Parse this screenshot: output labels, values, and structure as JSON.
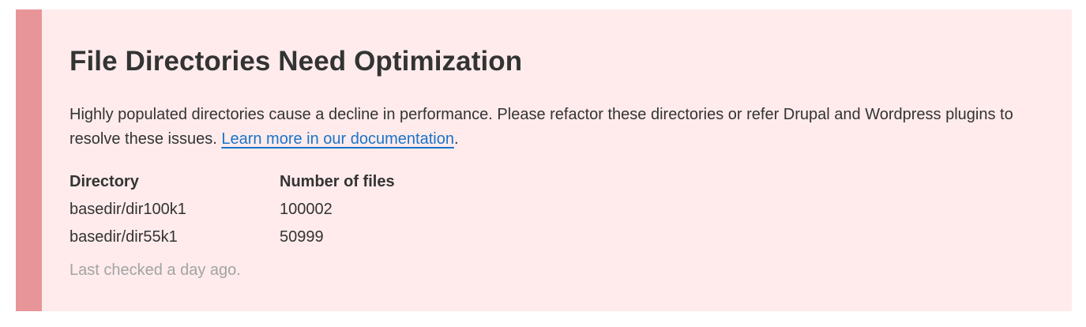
{
  "notice": {
    "title": "File Directories Need Optimization",
    "description_text": "Highly populated directories cause a decline in performance. Please refactor these directories or refer Drupal and Wordpress plugins to resolve these issues. ",
    "link_text": "Learn more in our documentation",
    "trailing_punct": ".",
    "table": {
      "headers": {
        "directory": "Directory",
        "files": "Number of files"
      },
      "rows": [
        {
          "directory": "basedir/dir100k1",
          "files": "100002"
        },
        {
          "directory": "basedir/dir55k1",
          "files": "50999"
        }
      ]
    },
    "last_checked": "Last checked a day ago.",
    "colors": {
      "background": "#ffebec",
      "accent": "#e8959a",
      "link": "#1a73c9",
      "muted": "#a3a3a3"
    }
  }
}
